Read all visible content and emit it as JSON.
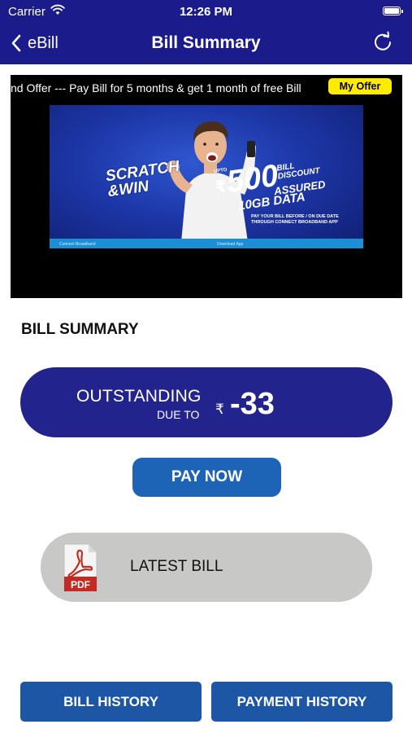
{
  "status_bar": {
    "carrier": "Carrier",
    "time": "12:26 PM",
    "icons": [
      "wifi-icon",
      "battery-icon"
    ]
  },
  "nav": {
    "back_label": "eBill",
    "title": "Bill Summary",
    "icons": [
      "chevron-left-icon",
      "refresh-icon"
    ]
  },
  "banner": {
    "ticker_text": "nd Offer --- Pay Bill for 5 months & get 1 month of free Bill",
    "offer_button": "My Offer",
    "promo": {
      "scratch_line1": "SCRATCH",
      "scratch_line2": "&WIN",
      "upto": "UPTO",
      "currency": "₹",
      "amount": "500",
      "bill_line1": "BILL",
      "bill_line2": "DISCOUNT",
      "assured": "ASSURED",
      "data": "10GB DATA",
      "pay_line1": "PAY YOUR BILL BEFORE / ON DUE DATE",
      "pay_line2": "THROUGH CONNECT BROADBAND APP",
      "footer_left": "Connect Broadband",
      "footer_right": "Download App"
    }
  },
  "summary": {
    "section_title": "BILL SUMMARY",
    "outstanding_label": "OUTSTANDING",
    "due_label": "DUE TO",
    "currency_symbol": "₹",
    "amount": "-33"
  },
  "actions": {
    "pay_now": "PAY NOW",
    "latest_bill": "LATEST BILL",
    "pdf_badge": "PDF",
    "bill_history": "BILL HISTORY",
    "payment_history": "PAYMENT HISTORY"
  },
  "colors": {
    "header": "#1b1b8c",
    "outstanding_pill": "#22238c",
    "button_blue": "#1e64b6",
    "history_blue": "#1e56a6",
    "offer_yellow": "#ffeb00",
    "latest_bill_gray": "#c8c8c6",
    "pdf_red": "#c42a22"
  }
}
